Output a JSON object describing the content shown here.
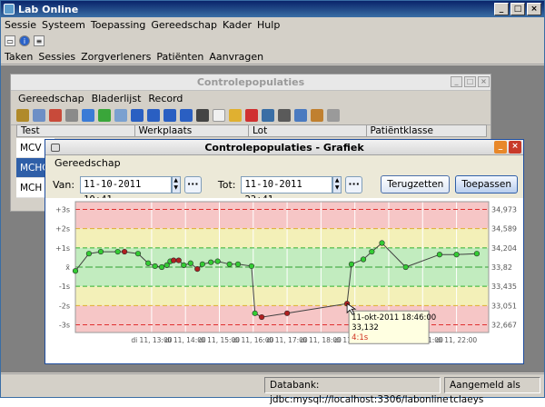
{
  "app": {
    "title": "Lab Online",
    "menu": [
      "Sessie",
      "Systeem",
      "Toepassing",
      "Gereedschap",
      "Kader",
      "Hulp"
    ],
    "nav": [
      "Taken",
      "Sessies",
      "Zorgverleners",
      "Patiënten",
      "Aanvragen"
    ]
  },
  "inner": {
    "title": "Controlepopulaties",
    "menu": [
      "Gereedschap",
      "Bladerlijst",
      "Record"
    ],
    "columns": [
      "Test",
      "Werkplaats",
      "Lot",
      "Patiëntklasse"
    ],
    "rows": [
      "MCV",
      "MCHC",
      "MCH"
    ]
  },
  "dialog": {
    "title": "Controlepopulaties - Grafiek",
    "menu": "Gereedschap",
    "van_label": "Van:",
    "van_value": "11-10-2011 10:41",
    "tot_label": "Tot:",
    "tot_value": "11-10-2011 23:41",
    "dots": "···",
    "reset": "Terugzetten",
    "apply": "Toepassen"
  },
  "status": {
    "db": "Databank: jdbc:mysql://localhost:3306/labonline",
    "user": "Aangemeld als tclaeys"
  },
  "chart_data": {
    "type": "line",
    "left_ticks": [
      "+3s",
      "+2s",
      "+1s",
      "x̄",
      "-1s",
      "-2s",
      "-3s"
    ],
    "right_ticks": [
      "34,973",
      "34,589",
      "34,204",
      "33,82",
      "33,435",
      "33,051",
      "32,667"
    ],
    "x_ticks": [
      "di 11, 13:00",
      "di 11, 14:00",
      "di 11, 15:00",
      "di 11, 16:00",
      "di 11, 17:00",
      "di 11, 18:00",
      "di 11, 19:00",
      "di 11, 20:00",
      "di 11, 21:00",
      "di 11, 22:00"
    ],
    "x_hours": [
      13,
      14,
      15,
      16,
      17,
      18,
      19,
      20,
      21,
      22
    ],
    "sd_points": [
      {
        "t": 10.75,
        "sd": -0.2
      },
      {
        "t": 11.15,
        "sd": 0.7
      },
      {
        "t": 11.5,
        "sd": 0.8
      },
      {
        "t": 12.0,
        "sd": 0.8
      },
      {
        "t": 12.2,
        "sd": 0.8
      },
      {
        "t": 12.6,
        "sd": 0.7
      },
      {
        "t": 12.9,
        "sd": 0.2
      },
      {
        "t": 13.1,
        "sd": 0.05
      },
      {
        "t": 13.3,
        "sd": 0.0
      },
      {
        "t": 13.45,
        "sd": 0.1
      },
      {
        "t": 13.55,
        "sd": 0.3
      },
      {
        "t": 13.65,
        "sd": 0.35
      },
      {
        "t": 13.8,
        "sd": 0.35
      },
      {
        "t": 13.95,
        "sd": 0.1
      },
      {
        "t": 14.15,
        "sd": 0.2
      },
      {
        "t": 14.35,
        "sd": -0.1
      },
      {
        "t": 14.5,
        "sd": 0.15
      },
      {
        "t": 14.75,
        "sd": 0.25
      },
      {
        "t": 14.95,
        "sd": 0.3
      },
      {
        "t": 15.3,
        "sd": 0.15
      },
      {
        "t": 15.55,
        "sd": 0.15
      },
      {
        "t": 15.95,
        "sd": 0.05
      },
      {
        "t": 16.05,
        "sd": -2.4
      },
      {
        "t": 16.25,
        "sd": -2.6
      },
      {
        "t": 17.0,
        "sd": -2.4
      },
      {
        "t": 18.77,
        "sd": -1.9
      },
      {
        "t": 18.9,
        "sd": 0.15
      },
      {
        "t": 19.25,
        "sd": 0.4
      },
      {
        "t": 19.5,
        "sd": 0.8
      },
      {
        "t": 19.8,
        "sd": 1.25
      },
      {
        "t": 20.5,
        "sd": 0.0
      },
      {
        "t": 21.5,
        "sd": 0.65
      },
      {
        "t": 22.0,
        "sd": 0.65
      },
      {
        "t": 22.6,
        "sd": 0.7
      }
    ],
    "red_points": [
      12.2,
      13.65,
      13.8,
      14.35,
      16.25,
      17.0,
      18.77
    ],
    "tooltip": {
      "line1": "11-okt-2011 18:46:00",
      "line2": "33,132",
      "line3": "4:1s"
    }
  }
}
